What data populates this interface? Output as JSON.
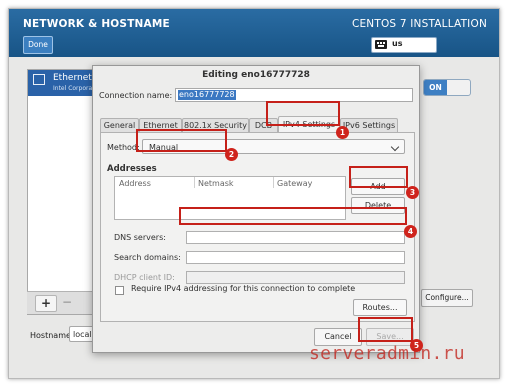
{
  "header": {
    "title": "NETWORK & HOSTNAME",
    "done_label": "Done",
    "install_title": "CENTOS 7 INSTALLATION",
    "keyboard_layout": "us"
  },
  "devices": {
    "items": [
      {
        "name": "Ethernet",
        "subtitle": "Intel Corporat"
      }
    ],
    "add_label": "+",
    "remove_label": "−"
  },
  "hostname": {
    "label": "Hostname:",
    "value": "local"
  },
  "toggle": {
    "state_label": "ON"
  },
  "configure_label": "Configure...",
  "dialog": {
    "title": "Editing eno16777728",
    "connection_name_label": "Connection name:",
    "connection_name_value": "eno16777728",
    "tabs": [
      {
        "label": "General"
      },
      {
        "label": "Ethernet"
      },
      {
        "label": "802.1x Security"
      },
      {
        "label": "DCB"
      },
      {
        "label": "IPv4 Settings",
        "active": true
      },
      {
        "label": "IPv6 Settings"
      }
    ],
    "method_label": "Method:",
    "method_value": "Manual",
    "addresses_heading": "Addresses",
    "columns": [
      "Address",
      "Netmask",
      "Gateway"
    ],
    "add_label": "Add",
    "delete_label": "Delete",
    "dns_label": "DNS servers:",
    "dns_value": "",
    "search_label": "Search domains:",
    "search_value": "",
    "dhcp_label": "DHCP client ID:",
    "dhcp_value": "",
    "require_label": "Require IPv4 addressing for this connection to complete",
    "require_checked": false,
    "routes_label": "Routes...",
    "cancel_label": "Cancel",
    "save_label": "Save..."
  },
  "annotations": {
    "markers": [
      "1",
      "2",
      "3",
      "4",
      "5"
    ],
    "highlight_color": "#c52019"
  },
  "watermark": "serveradmin.ru",
  "colors": {
    "header_blue": "#1c5d92",
    "selection_blue": "#2a62a8",
    "toggle_on": "#3d7fc3"
  }
}
